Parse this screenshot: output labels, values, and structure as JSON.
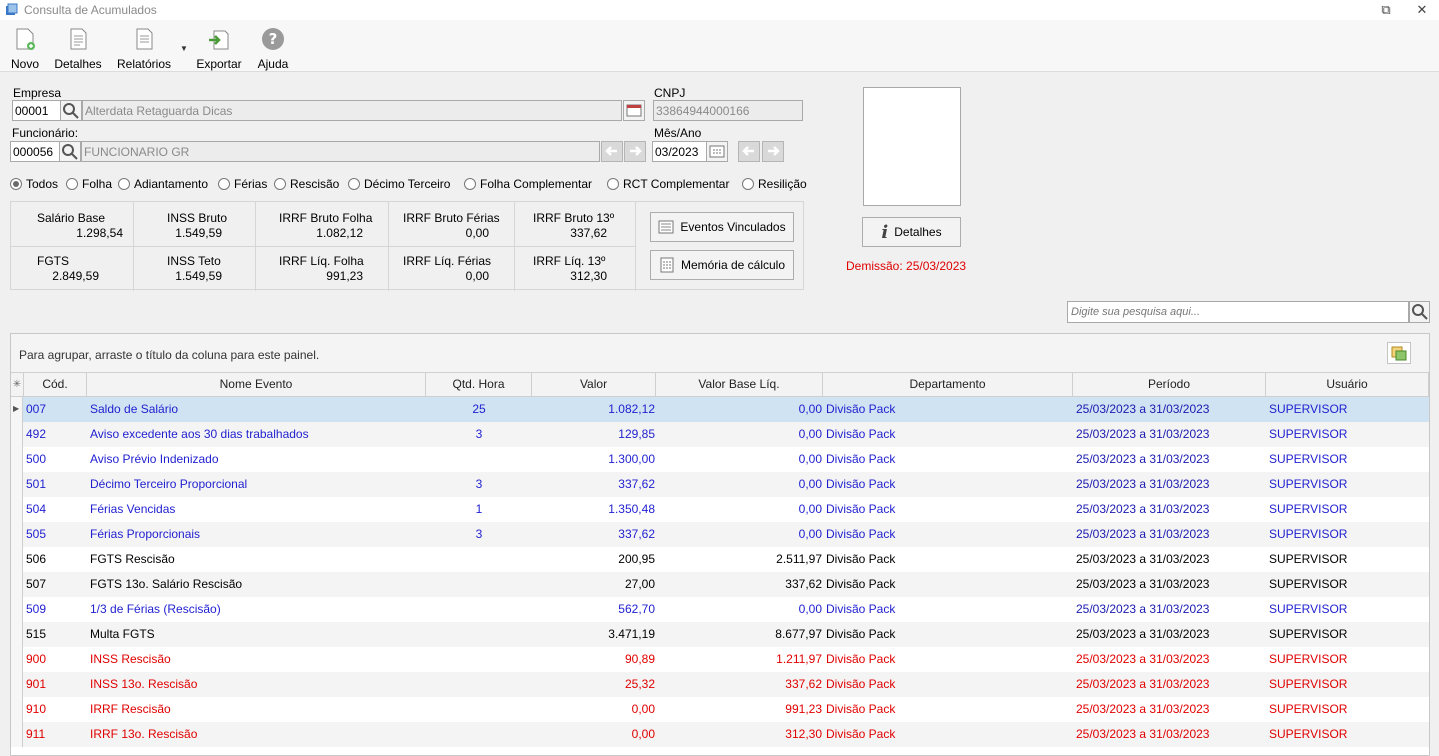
{
  "window": {
    "title": "Consulta de Acumulados"
  },
  "toolbar": {
    "novo": "Novo",
    "detalhes": "Detalhes",
    "relatorios": "Relatórios",
    "exportar": "Exportar",
    "ajuda": "Ajuda"
  },
  "form": {
    "empresa_label": "Empresa",
    "empresa_code": "00001",
    "empresa_name": "Alterdata Retaguarda Dicas",
    "cnpj_label": "CNPJ",
    "cnpj_value": "33864944000166",
    "funcionario_label": "Funcionário:",
    "funcionario_code": "000056",
    "funcionario_name": "FUNCIONARIO GR",
    "mesano_label": "Mês/Ano",
    "mesano_value": "03/2023"
  },
  "filters": [
    {
      "label": "Todos",
      "selected": true
    },
    {
      "label": "Folha",
      "selected": false
    },
    {
      "label": "Adiantamento",
      "selected": false
    },
    {
      "label": "Férias",
      "selected": false
    },
    {
      "label": "Rescisão",
      "selected": false
    },
    {
      "label": "Décimo Terceiro",
      "selected": false
    },
    {
      "label": "Folha Complementar",
      "selected": false
    },
    {
      "label": "RCT Complementar",
      "selected": false
    },
    {
      "label": "Resilição",
      "selected": false
    }
  ],
  "summary": {
    "row1": [
      {
        "name": "Salário Base",
        "value": "1.298,54"
      },
      {
        "name": "INSS Bruto",
        "value": "1.549,59"
      },
      {
        "name": "IRRF Bruto Folha",
        "value": "1.082,12"
      },
      {
        "name": "IRRF Bruto Férias",
        "value": "0,00"
      },
      {
        "name": "IRRF Bruto 13º",
        "value": "337,62"
      }
    ],
    "row2": [
      {
        "name": "FGTS",
        "value": "2.849,59"
      },
      {
        "name": "INSS Teto",
        "value": "1.549,59"
      },
      {
        "name": "IRRF Líq. Folha",
        "value": "991,23"
      },
      {
        "name": "IRRF Líq. Férias",
        "value": "0,00"
      },
      {
        "name": "IRRF Líq. 13º",
        "value": "312,30"
      }
    ]
  },
  "buttons": {
    "eventos_vinculados": "Eventos Vinculados",
    "memoria_calculo": "Memória de cálculo",
    "detalhes": "Detalhes"
  },
  "demissao": "Demissão: 25/03/2023",
  "search": {
    "placeholder": "Digite sua pesquisa aqui..."
  },
  "grid": {
    "group_hint": "Para agrupar, arraste o título da coluna para este painel.",
    "columns": [
      "Cód.",
      "Nome Evento",
      "Qtd. Hora",
      "Valor",
      "Valor Base Líq.",
      "Departamento",
      "Período",
      "Usuário"
    ],
    "rows": [
      {
        "cod": "007",
        "nome": "Saldo de Salário",
        "qtd": "25",
        "valor": "1.082,12",
        "base": "0,00",
        "depto": "Divisão Pack",
        "periodo": "25/03/2023 a 31/03/2023",
        "usuario": "SUPERVISOR",
        "color": "blue"
      },
      {
        "cod": "492",
        "nome": "Aviso excedente aos 30 dias trabalhados",
        "qtd": "3",
        "valor": "129,85",
        "base": "0,00",
        "depto": "Divisão Pack",
        "periodo": "25/03/2023 a 31/03/2023",
        "usuario": "SUPERVISOR",
        "color": "blue"
      },
      {
        "cod": "500",
        "nome": "Aviso Prévio Indenizado",
        "qtd": "",
        "valor": "1.300,00",
        "base": "0,00",
        "depto": "Divisão Pack",
        "periodo": "25/03/2023 a 31/03/2023",
        "usuario": "SUPERVISOR",
        "color": "blue"
      },
      {
        "cod": "501",
        "nome": "Décimo Terceiro Proporcional",
        "qtd": "3",
        "valor": "337,62",
        "base": "0,00",
        "depto": "Divisão Pack",
        "periodo": "25/03/2023 a 31/03/2023",
        "usuario": "SUPERVISOR",
        "color": "blue"
      },
      {
        "cod": "504",
        "nome": "Férias Vencidas",
        "qtd": "1",
        "valor": "1.350,48",
        "base": "0,00",
        "depto": "Divisão Pack",
        "periodo": "25/03/2023 a 31/03/2023",
        "usuario": "SUPERVISOR",
        "color": "blue"
      },
      {
        "cod": "505",
        "nome": "Férias Proporcionais",
        "qtd": "3",
        "valor": "337,62",
        "base": "0,00",
        "depto": "Divisão Pack",
        "periodo": "25/03/2023 a 31/03/2023",
        "usuario": "SUPERVISOR",
        "color": "blue"
      },
      {
        "cod": "506",
        "nome": "FGTS Rescisão",
        "qtd": "",
        "valor": "200,95",
        "base": "2.511,97",
        "depto": "Divisão Pack",
        "periodo": "25/03/2023 a 31/03/2023",
        "usuario": "SUPERVISOR",
        "color": "black"
      },
      {
        "cod": "507",
        "nome": "FGTS 13o. Salário Rescisão",
        "qtd": "",
        "valor": "27,00",
        "base": "337,62",
        "depto": "Divisão Pack",
        "periodo": "25/03/2023 a 31/03/2023",
        "usuario": "SUPERVISOR",
        "color": "black"
      },
      {
        "cod": "509",
        "nome": "1/3 de Férias (Rescisão)",
        "qtd": "",
        "valor": "562,70",
        "base": "0,00",
        "depto": "Divisão Pack",
        "periodo": "25/03/2023 a 31/03/2023",
        "usuario": "SUPERVISOR",
        "color": "blue"
      },
      {
        "cod": "515",
        "nome": "Multa FGTS",
        "qtd": "",
        "valor": "3.471,19",
        "base": "8.677,97",
        "depto": "Divisão Pack",
        "periodo": "25/03/2023 a 31/03/2023",
        "usuario": "SUPERVISOR",
        "color": "black"
      },
      {
        "cod": "900",
        "nome": "INSS  Rescisão",
        "qtd": "",
        "valor": "90,89",
        "base": "1.211,97",
        "depto": "Divisão Pack",
        "periodo": "25/03/2023 a 31/03/2023",
        "usuario": "SUPERVISOR",
        "color": "red"
      },
      {
        "cod": "901",
        "nome": "INSS 13o. Rescisão",
        "qtd": "",
        "valor": "25,32",
        "base": "337,62",
        "depto": "Divisão Pack",
        "periodo": "25/03/2023 a 31/03/2023",
        "usuario": "SUPERVISOR",
        "color": "red"
      },
      {
        "cod": "910",
        "nome": "IRRF Rescisão",
        "qtd": "",
        "valor": "0,00",
        "base": "991,23",
        "depto": "Divisão Pack",
        "periodo": "25/03/2023 a 31/03/2023",
        "usuario": "SUPERVISOR",
        "color": "red"
      },
      {
        "cod": "911",
        "nome": "IRRF 13o. Rescisão",
        "qtd": "",
        "valor": "0,00",
        "base": "312,30",
        "depto": "Divisão Pack",
        "periodo": "25/03/2023 a 31/03/2023",
        "usuario": "SUPERVISOR",
        "color": "red"
      }
    ]
  },
  "colors": {
    "blue_text": "#1f1fd0",
    "red_text": "#e00000",
    "selected_row": "#cfe3f2"
  }
}
